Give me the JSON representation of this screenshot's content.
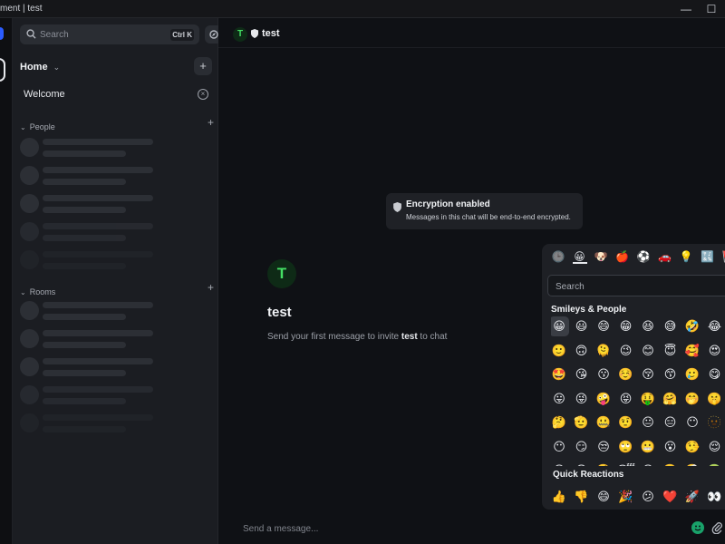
{
  "window": {
    "title": "ment | test",
    "minimize_glyph": "—",
    "maximize_glyph": "☐"
  },
  "sidebar": {
    "search": {
      "placeholder": "Search",
      "shortcut": "Ctrl K"
    },
    "home": {
      "label": "Home"
    },
    "welcome": {
      "label": "Welcome"
    },
    "people": {
      "label": "People"
    },
    "rooms": {
      "label": "Rooms"
    }
  },
  "room": {
    "avatar_letter": "T",
    "name": "test",
    "encryption": {
      "title": "Encryption enabled",
      "description": "Messages in this chat will be end-to-end encrypted."
    },
    "intro_prefix": "Send your first message to invite ",
    "intro_name": "test",
    "intro_suffix": " to chat"
  },
  "composer": {
    "placeholder": "Send a message..."
  },
  "emoji_picker": {
    "search_placeholder": "Search",
    "category_title": "Smileys & People",
    "quick_reactions_title": "Quick Reactions",
    "category_tabs": [
      {
        "icon": "clock-icon",
        "glyph": "🕒"
      },
      {
        "icon": "smiley-icon",
        "glyph": "😀"
      },
      {
        "icon": "dog-icon",
        "glyph": "🐶"
      },
      {
        "icon": "apple-icon",
        "glyph": "🍎"
      },
      {
        "icon": "ball-icon",
        "glyph": "⚽"
      },
      {
        "icon": "car-icon",
        "glyph": "🚗"
      },
      {
        "icon": "bulb-icon",
        "glyph": "💡"
      },
      {
        "icon": "symbols-icon",
        "glyph": "🔣"
      },
      {
        "icon": "flag-icon",
        "glyph": "🚩"
      }
    ],
    "grid": [
      [
        "😀",
        "😃",
        "😄",
        "😁",
        "😆",
        "😅",
        "🤣",
        "😂"
      ],
      [
        "🙂",
        "🙃",
        "🫠",
        "😉",
        "😊",
        "😇",
        "🥰",
        "😍"
      ],
      [
        "🤩",
        "😘",
        "😗",
        "☺️",
        "😚",
        "😙",
        "🥲",
        "😋"
      ],
      [
        "😛",
        "😜",
        "🤪",
        "😝",
        "🤑",
        "🤗",
        "🤭",
        "🤫"
      ],
      [
        "🤔",
        "🫡",
        "🤐",
        "🤨",
        "😐",
        "😑",
        "😶",
        "🫥"
      ],
      [
        "😶",
        "😏",
        "😒",
        "🙄",
        "😬",
        "😮",
        "🤥",
        "😌"
      ],
      [
        "😔",
        "😪",
        "🤤",
        "😴",
        "😷",
        "🤒",
        "🤕",
        "🤢"
      ]
    ],
    "quick_reactions": [
      "👍",
      "👎",
      "😄",
      "🎉",
      "😕",
      "❤️",
      "🚀",
      "👀"
    ]
  },
  "colors": {
    "accent_green": "#44e064",
    "emoji_button": "#19a26a"
  }
}
